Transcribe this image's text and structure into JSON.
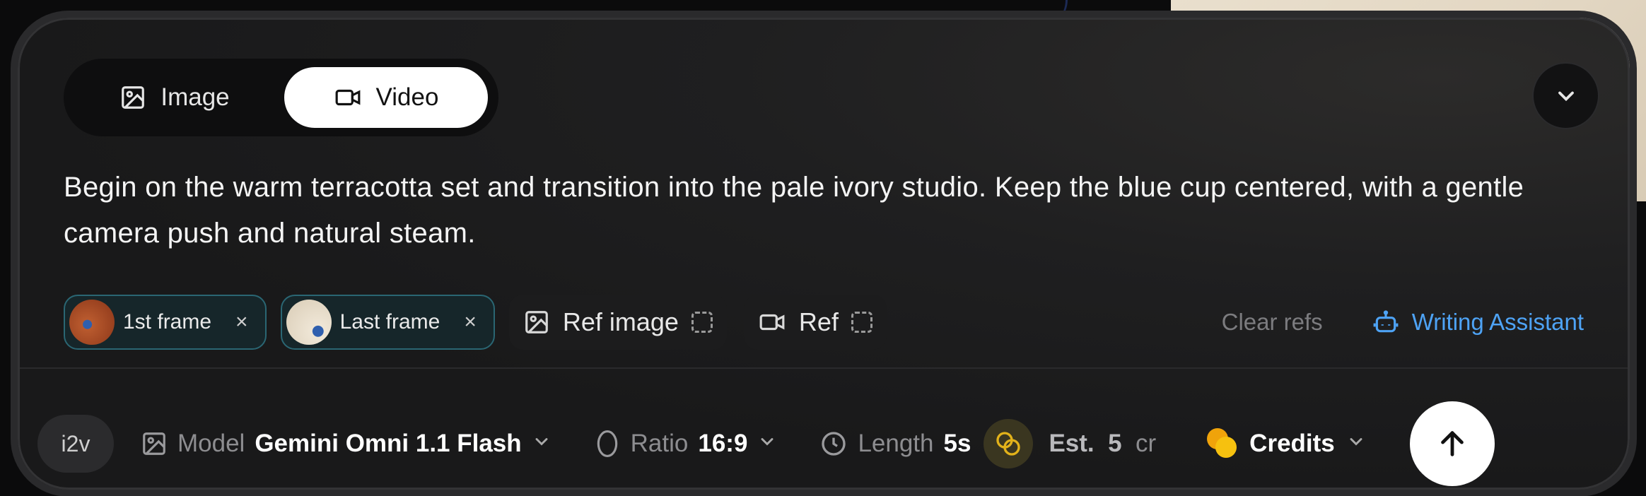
{
  "mode_toggle": {
    "image_label": "Image",
    "video_label": "Video",
    "selected": "Video"
  },
  "prompt": {
    "text": "Begin on the warm terracotta set and transition into the pale ivory studio. Keep the blue cup centered, with a gentle camera push and natural steam."
  },
  "refs": {
    "first_frame_label": "1st frame",
    "last_frame_label": "Last frame",
    "ref_image_label": "Ref image",
    "ref_video_label": "Ref",
    "clear_label": "Clear refs",
    "assistant_label": "Writing Assistant",
    "remove_glyph": "×"
  },
  "settings": {
    "mode_badge": "i2v",
    "model_label": "Model",
    "model_value": "Gemini Omni 1.1 Flash",
    "ratio_label": "Ratio",
    "ratio_value": "16:9",
    "length_label": "Length",
    "length_value": "5s",
    "est_label": "Est.",
    "est_value": "5",
    "est_unit": "cr",
    "credits_label": "Credits"
  },
  "colors": {
    "accent_blue": "#4ea3f5",
    "chip_border": "#2a6673",
    "coin_gold": "#f6c10f"
  },
  "icons": [
    "image-icon",
    "video-icon",
    "chevron-down-icon",
    "robot-icon",
    "circle-ratio-icon",
    "clock-icon",
    "coins-icon",
    "arrow-up-icon"
  ]
}
